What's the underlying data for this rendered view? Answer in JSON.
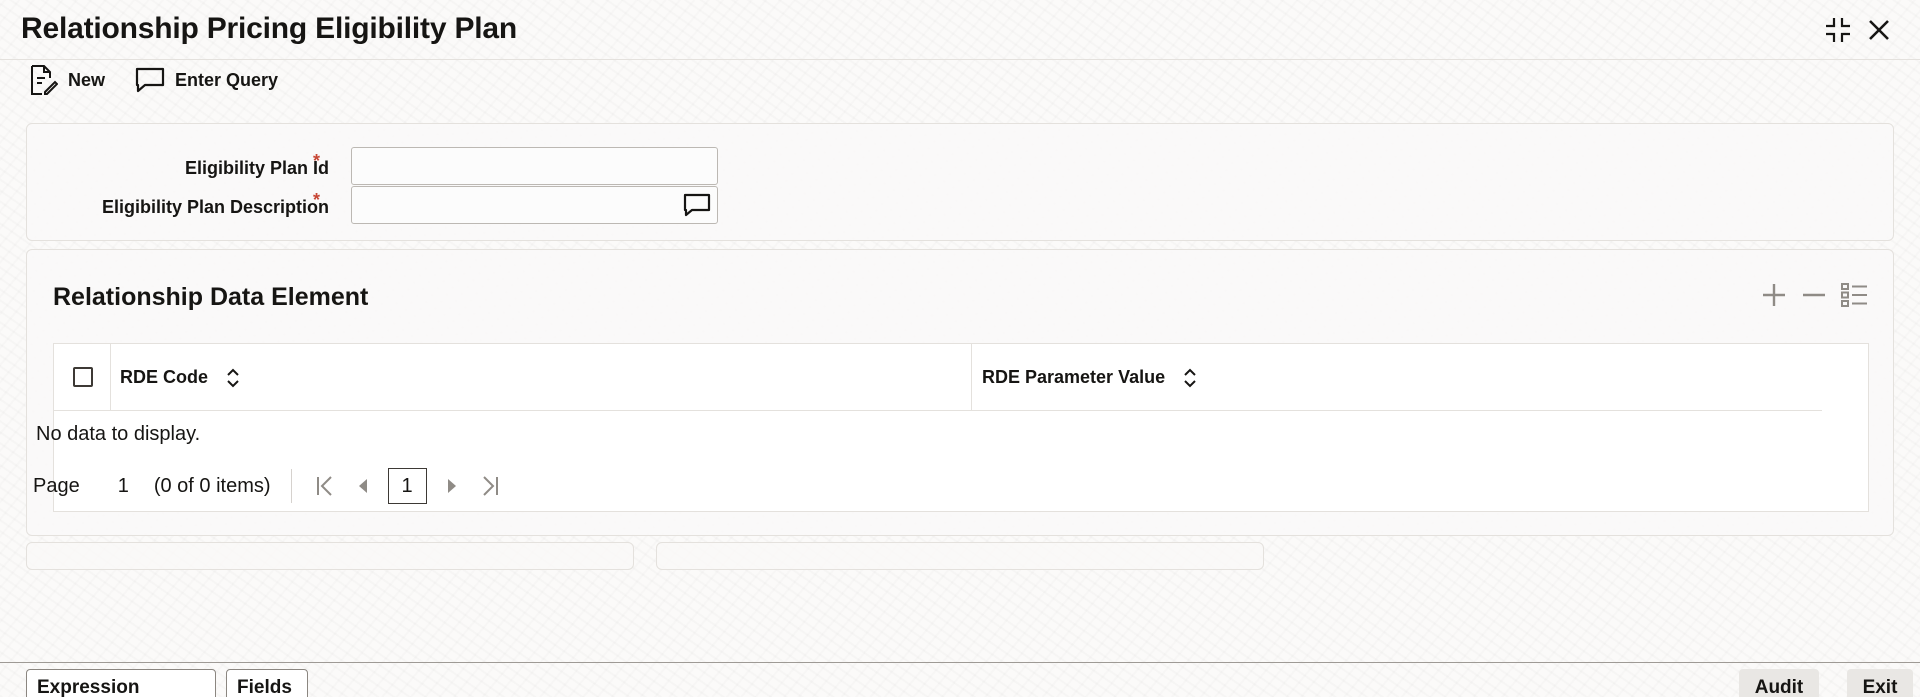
{
  "header": {
    "title": "Relationship Pricing Eligibility Plan"
  },
  "window_icons": {
    "minimize": "collapse-icon",
    "close": "close-icon"
  },
  "toolbar": {
    "new_label": "New",
    "enter_query_label": "Enter Query"
  },
  "form": {
    "plan_id_label": "Eligibility Plan Id",
    "plan_id_value": "",
    "plan_desc_label": "Eligibility Plan Description",
    "plan_desc_value": "",
    "required_mark": "*"
  },
  "grid": {
    "title": "Relationship Data Element",
    "columns": [
      "RDE Code",
      "RDE Parameter Value"
    ],
    "empty_text": "No data to display.",
    "pager": {
      "page_label": "Page",
      "page_number": "1",
      "items_text": "(0 of 0 items)",
      "current_page": "1"
    }
  },
  "footer": {
    "expression_builder": "Expression Builder",
    "fields": "Fields",
    "audit": "Audit",
    "exit": "Exit"
  },
  "colors": {
    "required": "#c74634",
    "text": "#161513",
    "border": "#e4e1dd"
  }
}
